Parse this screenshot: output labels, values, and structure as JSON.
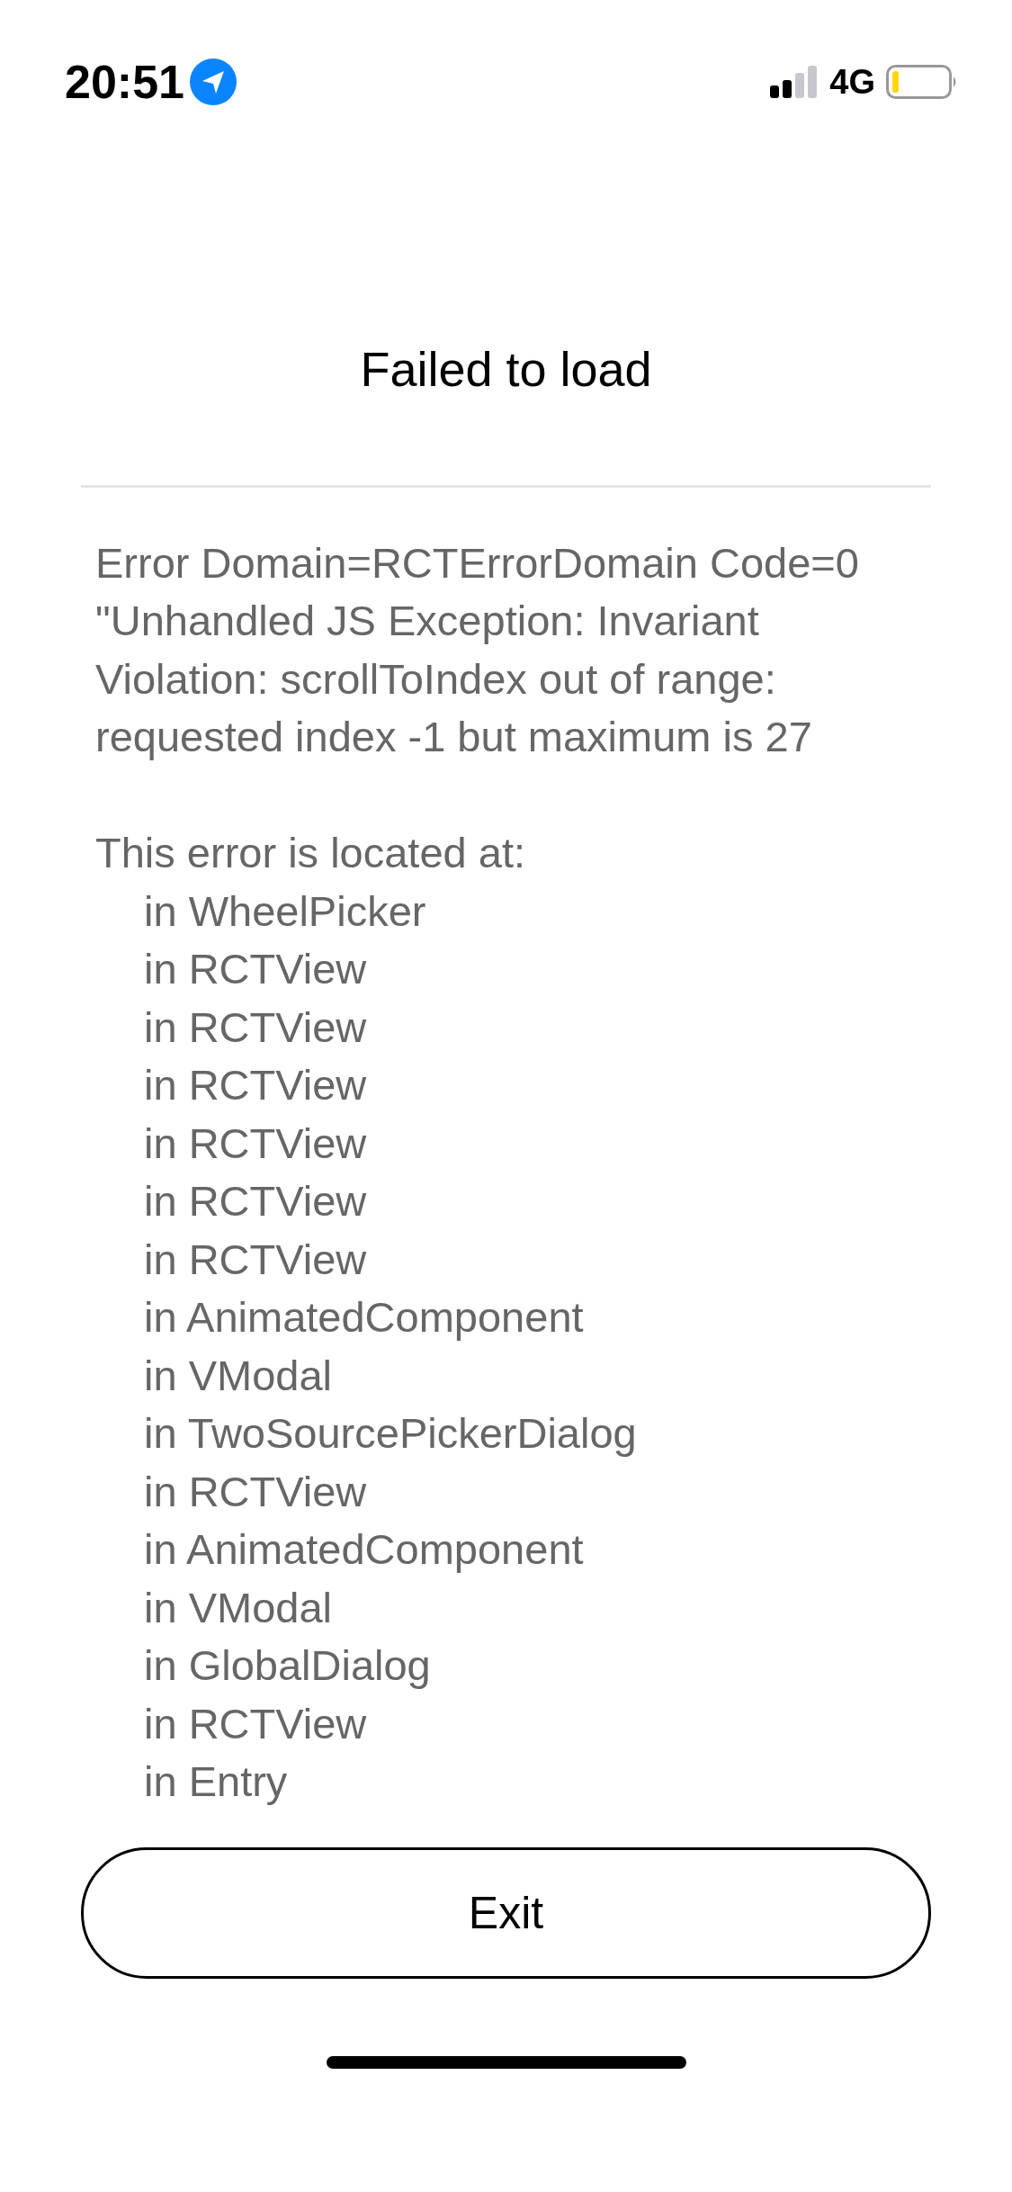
{
  "status_bar": {
    "time": "20:51",
    "network": "4G"
  },
  "title": "Failed to load",
  "error": {
    "message": "Error Domain=RCTErrorDomain Code=0 \"Unhandled JS Exception: Invariant Violation: scrollToIndex out of range: requested index -1 but maximum is 27",
    "location_heading": "This error is located at:",
    "stack": [
      "in WheelPicker",
      "in RCTView",
      "in RCTView",
      "in RCTView",
      "in RCTView",
      "in RCTView",
      "in RCTView",
      "in AnimatedComponent",
      "in VModal",
      "in TwoSourcePickerDialog",
      "in RCTView",
      "in AnimatedComponent",
      "in VModal",
      "in GlobalDialog",
      "in RCTView",
      "in Entry"
    ]
  },
  "exit_button": "Exit"
}
